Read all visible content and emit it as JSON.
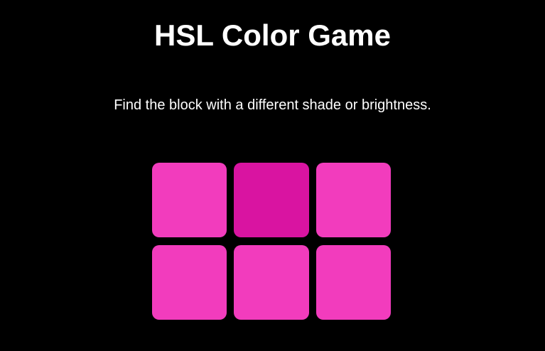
{
  "game": {
    "title": "HSL Color Game",
    "instructions": "Find the block with a different shade or brightness."
  },
  "colors": {
    "background": "#000000",
    "text": "#ffffff",
    "base_block": "#f23cbd",
    "odd_block": "#d914a1"
  },
  "grid": {
    "rows": 2,
    "columns": 3,
    "blocks": [
      {
        "color": "#f23cbd",
        "odd": false
      },
      {
        "color": "#d914a1",
        "odd": true
      },
      {
        "color": "#f23cbd",
        "odd": false
      },
      {
        "color": "#f23cbd",
        "odd": false
      },
      {
        "color": "#f23cbd",
        "odd": false
      },
      {
        "color": "#f23cbd",
        "odd": false
      }
    ]
  }
}
